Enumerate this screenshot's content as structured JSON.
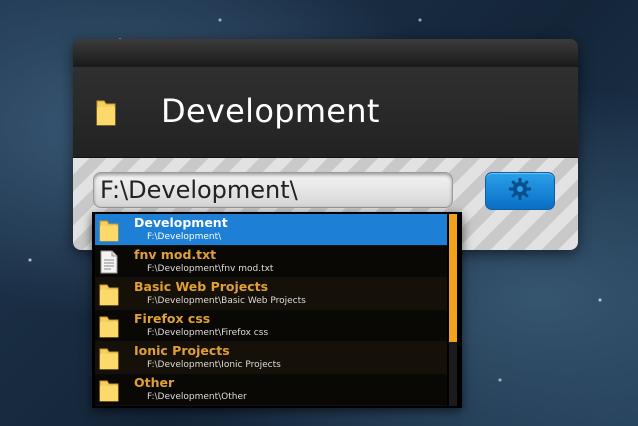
{
  "header": {
    "title": "Development",
    "icon": "folder-icon"
  },
  "search": {
    "value": "F:\\Development\\",
    "placeholder": ""
  },
  "settings_button": {
    "icon": "gear-icon"
  },
  "results": [
    {
      "name": "Development",
      "path": "F:\\Development\\",
      "icon": "folder-icon",
      "selected": true
    },
    {
      "name": "fnv mod.txt",
      "path": "F:\\Development\\fnv mod.txt",
      "icon": "text-file-icon",
      "selected": false
    },
    {
      "name": "Basic Web Projects",
      "path": "F:\\Development\\Basic Web Projects",
      "icon": "folder-icon",
      "selected": false
    },
    {
      "name": "Firefox css",
      "path": "F:\\Development\\Firefox css",
      "icon": "folder-icon",
      "selected": false
    },
    {
      "name": "Ionic Projects",
      "path": "F:\\Development\\Ionic Projects",
      "icon": "folder-icon",
      "selected": false
    },
    {
      "name": "Other",
      "path": "F:\\Development\\Other",
      "icon": "folder-icon",
      "selected": false
    }
  ],
  "colors": {
    "selection": "#1d7fd6",
    "item_name": "#e0a034",
    "scroll_thumb": "#f2a11b",
    "button": "#1b8de0"
  }
}
